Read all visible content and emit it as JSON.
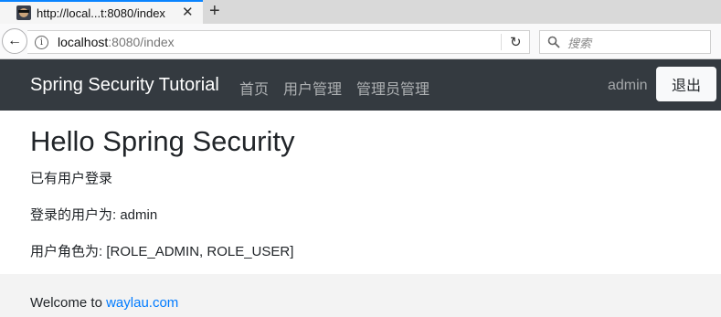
{
  "browser": {
    "tab_title": "http://local...t:8080/index",
    "close_glyph": "✕",
    "new_tab_glyph": "+",
    "url_host": "localhost",
    "url_rest": ":8080/index",
    "search_placeholder": "搜索",
    "back_glyph": "←",
    "reload_glyph": "↻",
    "info_glyph": "i"
  },
  "navbar": {
    "brand": "Spring Security Tutorial",
    "links": [
      "首页",
      "用户管理",
      "管理员管理"
    ],
    "username": "admin",
    "logout_label": "退出"
  },
  "main": {
    "heading": "Hello Spring Security",
    "status": "已有用户登录",
    "user_line": "登录的用户为: admin",
    "roles_line": "用户角色为: [ROLE_ADMIN, ROLE_USER]"
  },
  "footer": {
    "prefix": "Welcome to ",
    "link_text": "waylau.com"
  },
  "colors": {
    "navbar_bg": "#343a40",
    "link": "#007bff",
    "footer_bg": "#f3f3f3",
    "tab_accent": "#0a84ff"
  },
  "icons": [
    "favicon",
    "close-icon",
    "plus-icon",
    "back-arrow-icon",
    "info-icon",
    "reload-icon",
    "search-icon"
  ]
}
